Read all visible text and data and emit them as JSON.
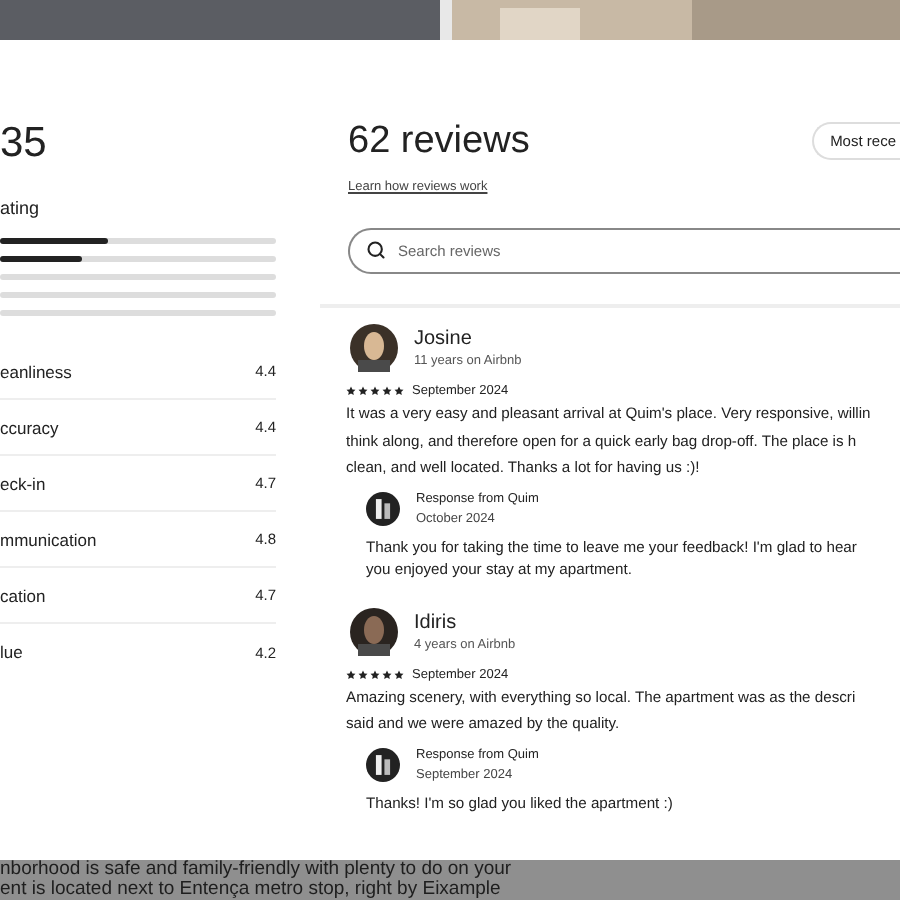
{
  "overall": {
    "score": "35",
    "heading": "ating",
    "bars": [
      {
        "kind": "filled",
        "level": 0.39
      },
      {
        "kind": "filled",
        "level": 0.3
      },
      {
        "kind": "empty"
      },
      {
        "kind": "empty"
      },
      {
        "kind": "empty"
      }
    ]
  },
  "categories": [
    {
      "label": "eanliness",
      "value": "4.4"
    },
    {
      "label": "ccuracy",
      "value": "4.4"
    },
    {
      "label": "eck-in",
      "value": "4.7"
    },
    {
      "label": "mmunication",
      "value": "4.8"
    },
    {
      "label": "cation",
      "value": "4.7"
    },
    {
      "label": "lue",
      "value": "4.2"
    }
  ],
  "reviews_header": {
    "title": "62 reviews",
    "link": "Learn how reviews work",
    "sort_button": "Most rece"
  },
  "search": {
    "placeholder": "Search reviews"
  },
  "reviews": [
    {
      "name": "Josine",
      "tenure": "11 years on Airbnb",
      "stars": 5,
      "date": "September 2024",
      "text_lines": [
        "It was a very easy and pleasant arrival at Quim's place. Very responsive, willin",
        "think along, and therefore open for a quick early bag drop-off. The place is h",
        "clean, and well located. Thanks a lot for having us :)!"
      ],
      "response": {
        "title": "Response from Quim",
        "date": "October 2024",
        "text_lines": [
          "Thank you for taking the time to leave me your feedback! I'm glad to hear",
          "you enjoyed your stay at my apartment."
        ]
      }
    },
    {
      "name": "Idiris",
      "tenure": "4 years on Airbnb",
      "stars": 5,
      "date": "September 2024",
      "text_lines": [
        "Amazing scenery, with everything so local. The apartment was as the descri",
        "said and we were amazed by the quality."
      ],
      "response": {
        "title": "Response from Quim",
        "date": "September 2024",
        "text_lines": [
          "Thanks! I'm so glad you liked the apartment :)"
        ]
      }
    }
  ],
  "background_text": [
    "nborhood is safe and family-friendly with plenty to do on your",
    "ent is located next to Entença metro stop, right by Eixample"
  ]
}
